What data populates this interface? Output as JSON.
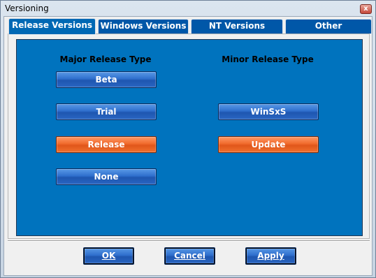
{
  "window": {
    "title": "Versioning",
    "close_glyph": "x"
  },
  "tabs": [
    {
      "label": "Release Versions",
      "active": true
    },
    {
      "label": "Windows Versions",
      "active": false
    },
    {
      "label": "NT Versions",
      "active": false
    },
    {
      "label": "Other",
      "active": false
    }
  ],
  "major": {
    "heading": "Major Release Type",
    "buttons": [
      {
        "label": "Beta",
        "selected": false
      },
      {
        "label": "Trial",
        "selected": false
      },
      {
        "label": "Release",
        "selected": true
      },
      {
        "label": "None",
        "selected": false
      }
    ]
  },
  "minor": {
    "heading": "Minor Release Type",
    "buttons": [
      {
        "label": "WinSxS",
        "selected": false
      },
      {
        "label": "Update",
        "selected": true
      }
    ]
  },
  "footer": {
    "ok_label": "OK",
    "cancel_label": "Cancel",
    "apply_label": "Apply"
  },
  "colors": {
    "panel_blue": "#0073be",
    "button_blue": "#2f6fcd",
    "selected_orange": "#f06a2c"
  }
}
